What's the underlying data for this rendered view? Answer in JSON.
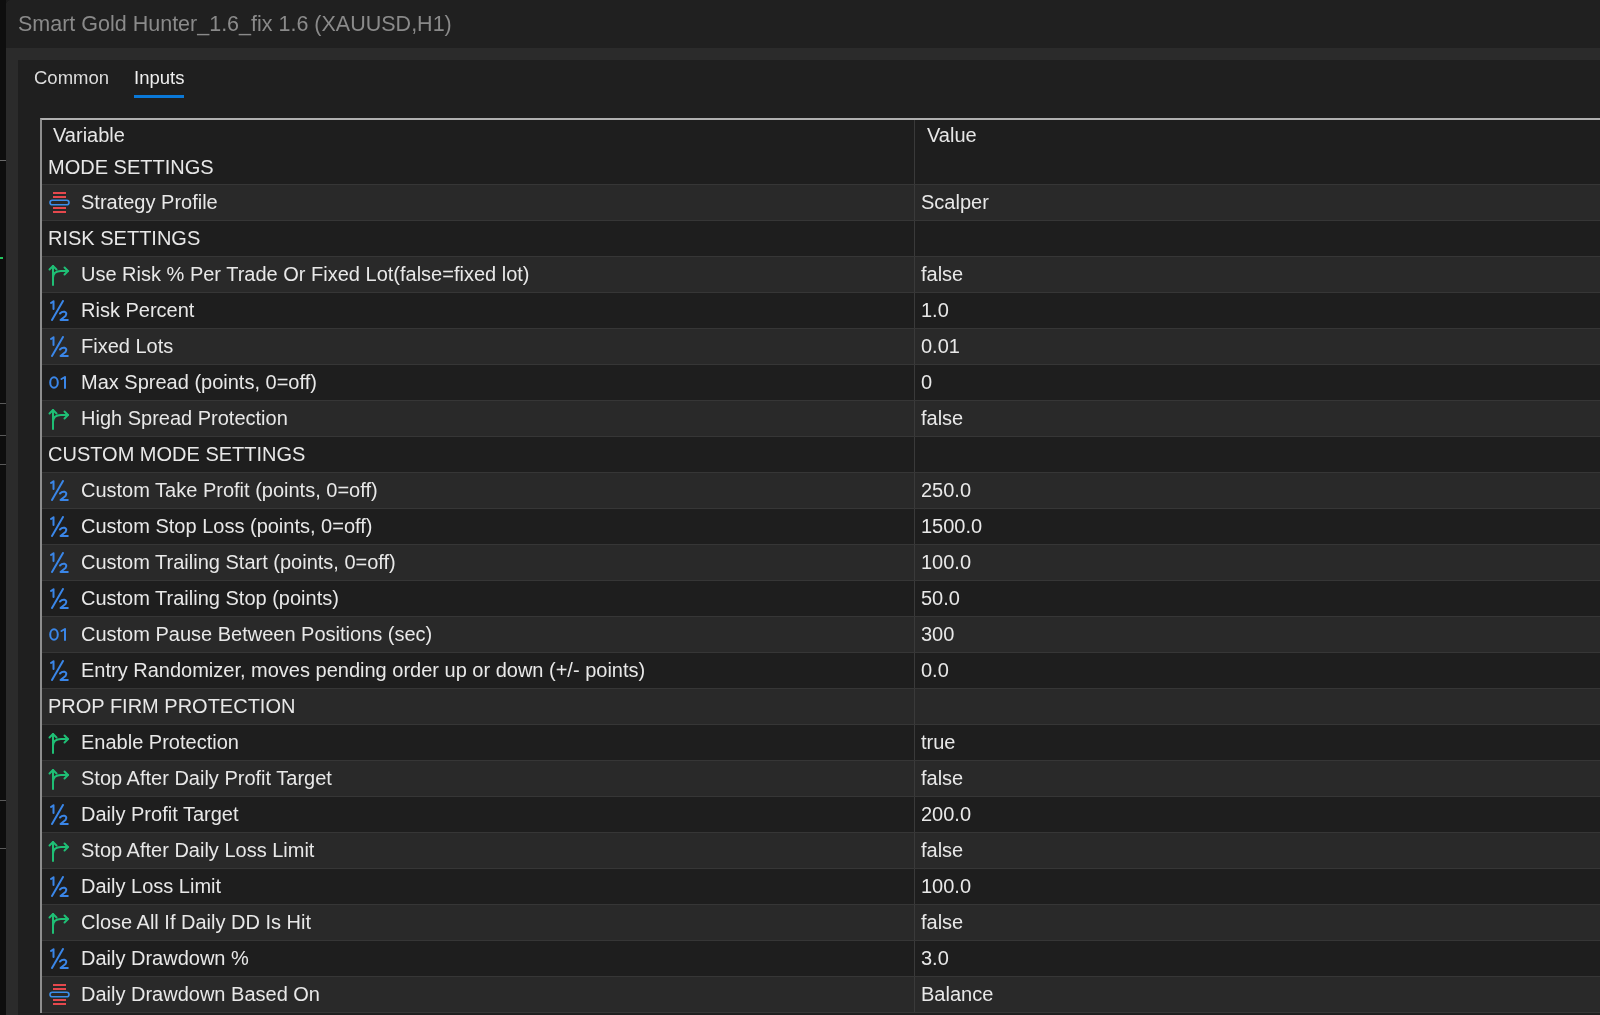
{
  "window": {
    "title": "Smart Gold Hunter_1.6_fix 1.6 (XAUUSD,H1)"
  },
  "tabs": [
    {
      "label": "Common",
      "selected": false
    },
    {
      "label": "Inputs",
      "selected": true
    }
  ],
  "table": {
    "columns": [
      "Variable",
      "Value"
    ],
    "rows": [
      {
        "kind": "group",
        "label": "MODE SETTINGS"
      },
      {
        "kind": "enum",
        "label": "Strategy Profile",
        "value": "Scalper"
      },
      {
        "kind": "group",
        "label": "RISK SETTINGS"
      },
      {
        "kind": "bool",
        "label": "Use Risk % Per Trade Or Fixed Lot(false=fixed lot)",
        "value": "false"
      },
      {
        "kind": "double",
        "label": "Risk Percent",
        "value": "1.0"
      },
      {
        "kind": "double",
        "label": "Fixed Lots",
        "value": "0.01"
      },
      {
        "kind": "int",
        "label": "Max Spread (points, 0=off)",
        "value": "0"
      },
      {
        "kind": "bool",
        "label": "High Spread Protection",
        "value": "false"
      },
      {
        "kind": "group",
        "label": "CUSTOM MODE SETTINGS"
      },
      {
        "kind": "double",
        "label": "Custom Take Profit (points, 0=off)",
        "value": "250.0"
      },
      {
        "kind": "double",
        "label": "Custom Stop Loss (points, 0=off)",
        "value": "1500.0"
      },
      {
        "kind": "double",
        "label": "Custom Trailing Start (points, 0=off)",
        "value": "100.0"
      },
      {
        "kind": "double",
        "label": "Custom Trailing Stop (points)",
        "value": "50.0"
      },
      {
        "kind": "int",
        "label": "Custom Pause Between Positions (sec)",
        "value": "300"
      },
      {
        "kind": "double",
        "label": "Entry Randomizer, moves pending order up or down (+/- points)",
        "value": "0.0"
      },
      {
        "kind": "group",
        "label": "PROP FIRM PROTECTION"
      },
      {
        "kind": "bool",
        "label": "Enable Protection",
        "value": "true"
      },
      {
        "kind": "bool",
        "label": "Stop After Daily Profit Target",
        "value": "false"
      },
      {
        "kind": "double",
        "label": "Daily Profit Target",
        "value": "200.0"
      },
      {
        "kind": "bool",
        "label": "Stop After Daily Loss Limit",
        "value": "false"
      },
      {
        "kind": "double",
        "label": "Daily Loss Limit",
        "value": "100.0"
      },
      {
        "kind": "bool",
        "label": "Close All If Daily DD Is Hit",
        "value": "false"
      },
      {
        "kind": "double",
        "label": "Daily Drawdown %",
        "value": "3.0"
      },
      {
        "kind": "enum",
        "label": "Daily Drawdown Based On",
        "value": "Balance"
      }
    ]
  }
}
